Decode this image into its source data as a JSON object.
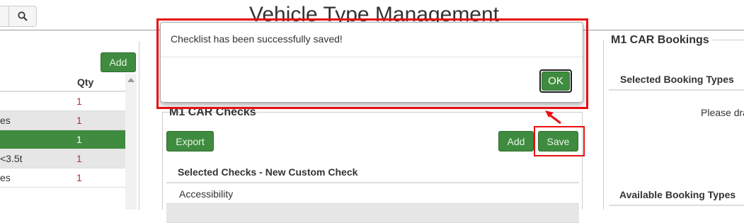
{
  "header": {
    "title": "Vehicle Type Management",
    "search_icon": "search-icon"
  },
  "left_list": {
    "add_label": "Add",
    "qty_header": "Qty",
    "rows": [
      {
        "name": "",
        "qty": "1"
      },
      {
        "name": "es",
        "qty": "1"
      },
      {
        "name": "",
        "qty": "1"
      },
      {
        "name": "<3.5t",
        "qty": "1"
      },
      {
        "name": "es",
        "qty": "1"
      }
    ]
  },
  "checks": {
    "title": "M1 CAR Checks",
    "export_label": "Export",
    "add_label": "Add",
    "save_label": "Save",
    "header": "Selected Checks - New Custom Check",
    "rows": [
      "Accessibility",
      ""
    ]
  },
  "bookings": {
    "title": "M1 CAR Bookings",
    "selected_header": "Selected Booking Types",
    "drag_hint": "Please dra",
    "available_header": "Available Booking Types"
  },
  "modal": {
    "message": "Checklist has been successfully saved!",
    "ok_label": "OK"
  },
  "colors": {
    "accent_green": "#3f8b3f",
    "highlight_red": "#e81010",
    "qty_red": "#aa3333"
  }
}
